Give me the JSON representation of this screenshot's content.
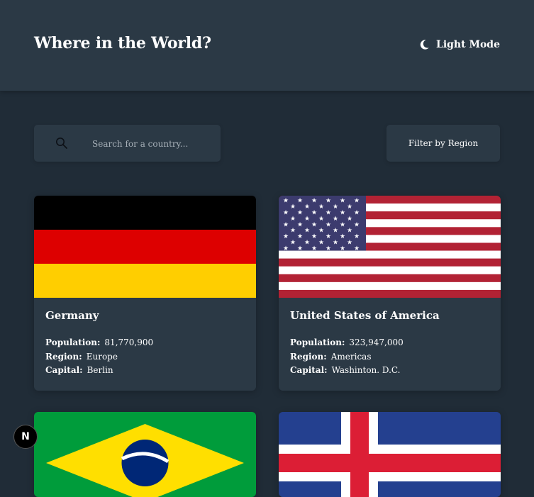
{
  "header": {
    "title": "Where in the World?",
    "mode_label": "Light Mode"
  },
  "search": {
    "placeholder": "Search for a country..."
  },
  "filter": {
    "label": "Filter by Region"
  },
  "labels": {
    "population": "Population:",
    "region": "Region:",
    "capital": "Capital:"
  },
  "countries": [
    {
      "name": "Germany",
      "population": "81,770,900",
      "region": "Europe",
      "capital": "Berlin",
      "flag_icon": "flag-germany-icon"
    },
    {
      "name": "United States of America",
      "population": "323,947,000",
      "region": "Americas",
      "capital": "Washinton. D.C.",
      "flag_icon": "flag-usa-icon"
    },
    {
      "name": "",
      "flag_icon": "flag-brazil-icon"
    },
    {
      "name": "",
      "flag_icon": "flag-iceland-icon"
    }
  ],
  "dev_badge": {
    "letter": "N",
    "icon": "nextjs-logo-icon"
  },
  "colors": {
    "background": "#202c37",
    "surface": "#2b3945",
    "text": "#ffffff"
  }
}
